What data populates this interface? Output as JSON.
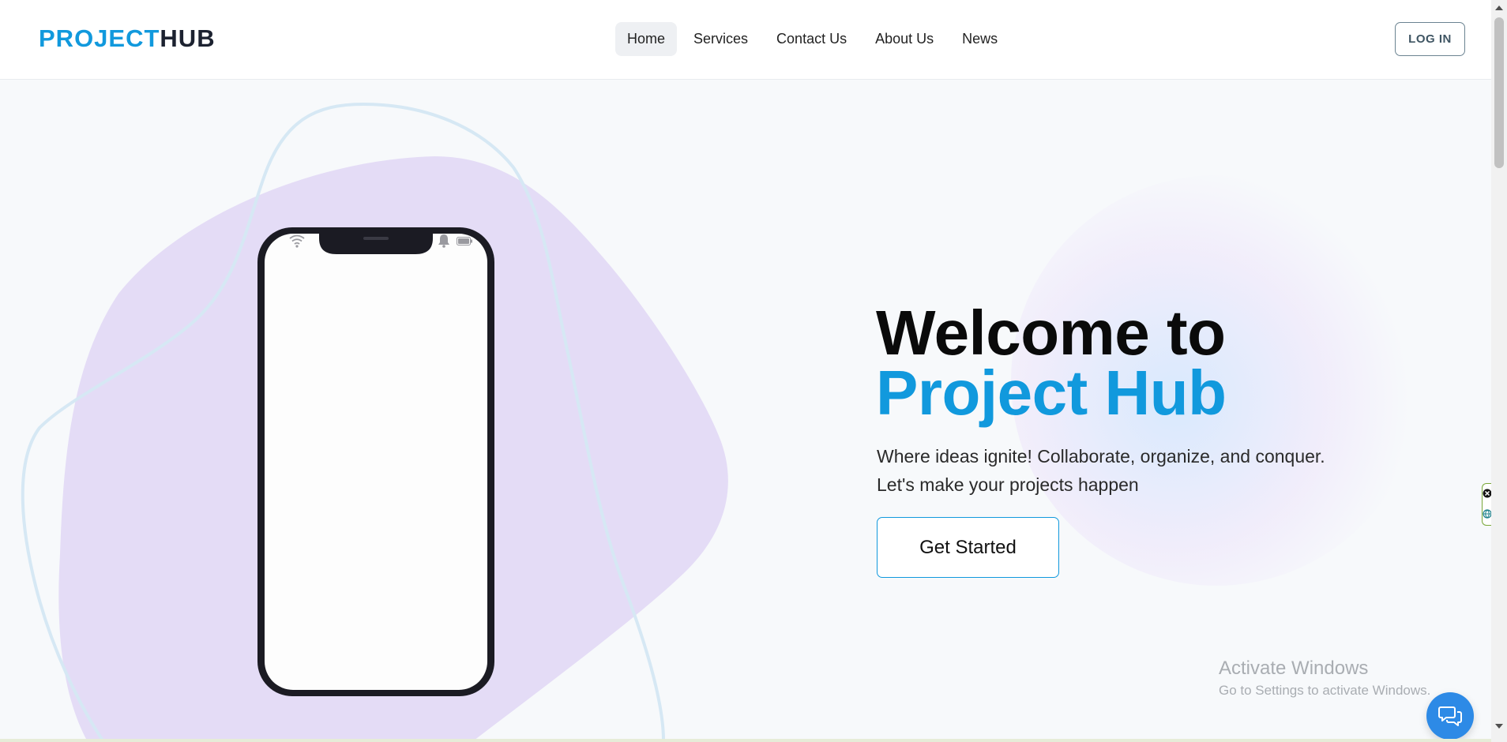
{
  "brand": {
    "part1": "PROJECT",
    "part2": "HUB"
  },
  "nav": {
    "items": [
      {
        "label": "Home",
        "active": true
      },
      {
        "label": "Services",
        "active": false
      },
      {
        "label": "Contact Us",
        "active": false
      },
      {
        "label": "About Us",
        "active": false
      },
      {
        "label": "News",
        "active": false
      }
    ],
    "login_label": "LOG IN"
  },
  "hero": {
    "title_line1": "Welcome to",
    "title_line2": "Project Hub",
    "subtitle_line1": "Where ideas ignite! Collaborate, organize, and conquer.",
    "subtitle_line2": "Let's make your projects happen",
    "cta_label": "Get Started"
  },
  "watermark": {
    "title": "Activate Windows",
    "subtitle": "Go to Settings to activate Windows."
  },
  "icons": {
    "chat": "chat-bubbles-icon",
    "wifi": "wifi-icon",
    "bell": "bell-icon",
    "battery": "battery-icon",
    "close": "close-icon",
    "globe": "globe-icon"
  },
  "colors": {
    "brand_blue": "#1199dd",
    "brand_dark": "#1c2230",
    "blob": "#e4dcf6",
    "fab": "#2d8ae6"
  }
}
